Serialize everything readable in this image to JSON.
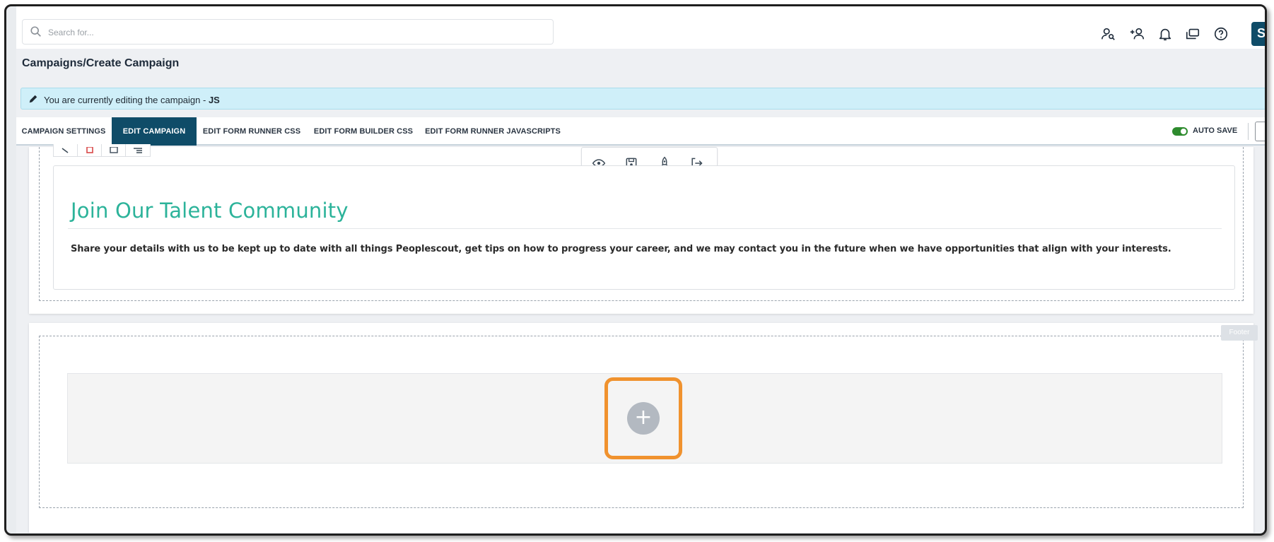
{
  "search": {
    "placeholder": "Search for..."
  },
  "header": {
    "icons": [
      "user-search-icon",
      "add-user-icon",
      "bell-icon",
      "windows-icon",
      "help-icon"
    ],
    "avatar_initial": "S"
  },
  "breadcrumb": "Campaigns/Create Campaign",
  "banner": {
    "text": "You are currently editing the campaign - ",
    "campaign": "JS"
  },
  "tabs": [
    {
      "label": "CAMPAIGN SETTINGS",
      "active": false
    },
    {
      "label": "EDIT CAMPAIGN",
      "active": true
    },
    {
      "label": "EDIT FORM RUNNER CSS",
      "active": false
    },
    {
      "label": "EDIT FORM BUILDER CSS",
      "active": false
    },
    {
      "label": "EDIT FORM RUNNER JAVASCRIPTS",
      "active": false
    }
  ],
  "autosave": {
    "label": "AUTO SAVE",
    "enabled": true
  },
  "toolbar": {
    "icons": [
      "preview-icon",
      "save-icon",
      "publish-icon",
      "exit-icon"
    ]
  },
  "section": {
    "heading": "Join Our Talent Community",
    "description": "Share your details with us to be kept up to date with all things Peoplescout, get tips on how to progress your career, and we may contact you in the future when we have opportunities that align with your interests."
  },
  "footer": {
    "tag": "Footer",
    "add_symbol": "+"
  },
  "colors": {
    "accent": "#0f4c68",
    "heading": "#2cb39a",
    "banner": "#cfeff9",
    "highlight": "#f0922e",
    "toggle_on": "#2e8b2e"
  }
}
